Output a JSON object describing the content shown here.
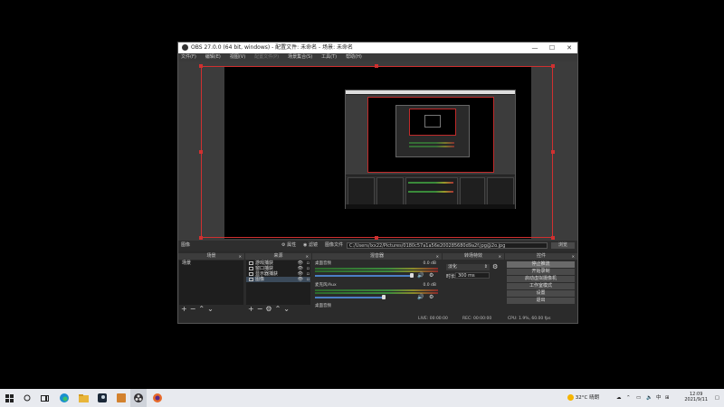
{
  "window": {
    "title": "OBS 27.0.0 (64 bit, windows) - 配置文件: 未命名 - 场景: 未命名",
    "minimize": "—",
    "maximize": "☐",
    "close": "✕"
  },
  "menu": [
    "文件(F)",
    "编辑(E)",
    "视图(V)",
    "配置文件(P)",
    "场景集合(S)",
    "工具(T)",
    "帮助(H)"
  ],
  "source_bar": {
    "source_name": "图像",
    "properties": "属性",
    "filters": "滤镜",
    "image_file_label": "图像文件",
    "path": "C:/Users/lxx22/Pictures/0180c57a1a56e200285680d9a2f.jpg@2o.jpg",
    "browse": "浏览"
  },
  "docks": {
    "scenes": {
      "title": "场景",
      "items": [
        "场景"
      ]
    },
    "sources": {
      "title": "来源",
      "items": [
        "游戏捕获",
        "窗口捕获",
        "显示器捕获",
        "图像"
      ]
    },
    "mixer": {
      "title": "混音器",
      "channels": [
        {
          "name": "桌面音频",
          "db": "0.0 dB",
          "volume": 0.85
        },
        {
          "name": "麦克风/Aux",
          "db": "0.0 dB",
          "volume": 0.6
        },
        {
          "name": "桌面音频",
          "db": "",
          "volume": 0.0
        }
      ]
    },
    "transitions": {
      "title": "转场特效",
      "type": "淡化",
      "duration_label": "时长",
      "duration": "300 ms"
    },
    "controls": {
      "title": "控件",
      "buttons": [
        "停止推流",
        "开始录制",
        "启动虚拟摄像机",
        "工作室模式",
        "设置",
        "退出"
      ]
    }
  },
  "status": {
    "live": "LIVE: 00:00:00",
    "rec": "REC: 00:00:00",
    "cpu": "CPU: 1.9%, 60.00 fps"
  },
  "taskbar": {
    "weather": "32°C 晴朗",
    "ime": "中",
    "time": "12:09",
    "date": "2021/9/11"
  }
}
